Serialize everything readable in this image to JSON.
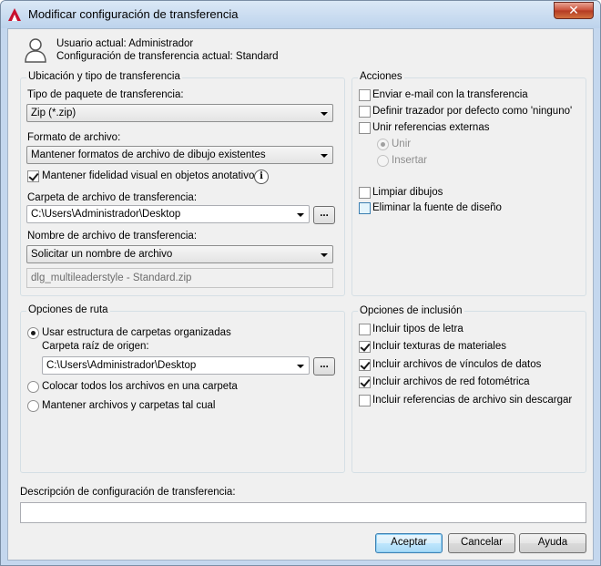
{
  "window": {
    "title": "Modificar configuración de transferencia",
    "close_glyph": "✕"
  },
  "user": {
    "current_user": "Usuario actual: Administrador",
    "current_setup": "Configuración de transferencia actual: Standard"
  },
  "location_group": {
    "title": "Ubicación y tipo de transferencia",
    "package_type_label": "Tipo de paquete de transferencia:",
    "package_type_value": "Zip (*.zip)",
    "file_format_label": "Formato de archivo:",
    "file_format_value": "Mantener formatos de archivo de dibujo existentes",
    "visual_fidelity_label": "Mantener fidelidad visual en objetos anotativos",
    "visual_fidelity_checked": true,
    "folder_label": "Carpeta de archivo de transferencia:",
    "folder_value": "C:\\Users\\Administrador\\Desktop",
    "browse_label": "...",
    "filename_label": "Nombre de archivo de transferencia:",
    "filename_value": "Solicitar un nombre de archivo",
    "filename_preview": "dlg_multileaderstyle - Standard.zip"
  },
  "actions_group": {
    "title": "Acciones",
    "items": [
      {
        "label": "Enviar e-mail con la transferencia",
        "checked": false
      },
      {
        "label": "Definir trazador por defecto como 'ninguno'",
        "checked": false
      },
      {
        "label": "Unir referencias externas",
        "checked": false
      }
    ],
    "bind_options": [
      {
        "label": "Unir",
        "checked": true
      },
      {
        "label": "Insertar",
        "checked": false
      }
    ],
    "extra_items": [
      {
        "label": "Limpiar dibujos",
        "checked": false
      },
      {
        "label": "Eliminar la fuente de diseño",
        "checked": false
      }
    ]
  },
  "path_group": {
    "title": "Opciones de ruta",
    "organized_label": "Usar estructura de carpetas organizadas",
    "root_label": "Carpeta raíz de origen:",
    "root_value": "C:\\Users\\Administrador\\Desktop",
    "browse_label": "...",
    "single_folder_label": "Colocar todos los archivos en una carpeta",
    "keep_as_is_label": "Mantener archivos y carpetas tal cual"
  },
  "include_group": {
    "title": "Opciones de inclusión",
    "items": [
      {
        "label": "Incluir tipos de letra",
        "checked": false
      },
      {
        "label": "Incluir texturas de materiales",
        "checked": true
      },
      {
        "label": "Incluir archivos de vínculos de datos",
        "checked": true
      },
      {
        "label": "Incluir archivos de red fotométrica",
        "checked": true
      },
      {
        "label": "Incluir referencias de archivo sin descargar",
        "checked": false
      }
    ]
  },
  "description": {
    "label": "Descripción de configuración de transferencia:",
    "value": ""
  },
  "buttons": {
    "ok": "Aceptar",
    "cancel": "Cancelar",
    "help": "Ayuda"
  },
  "icons": {
    "info": "i",
    "app": "autocad-logo-icon",
    "user": "user-icon"
  }
}
